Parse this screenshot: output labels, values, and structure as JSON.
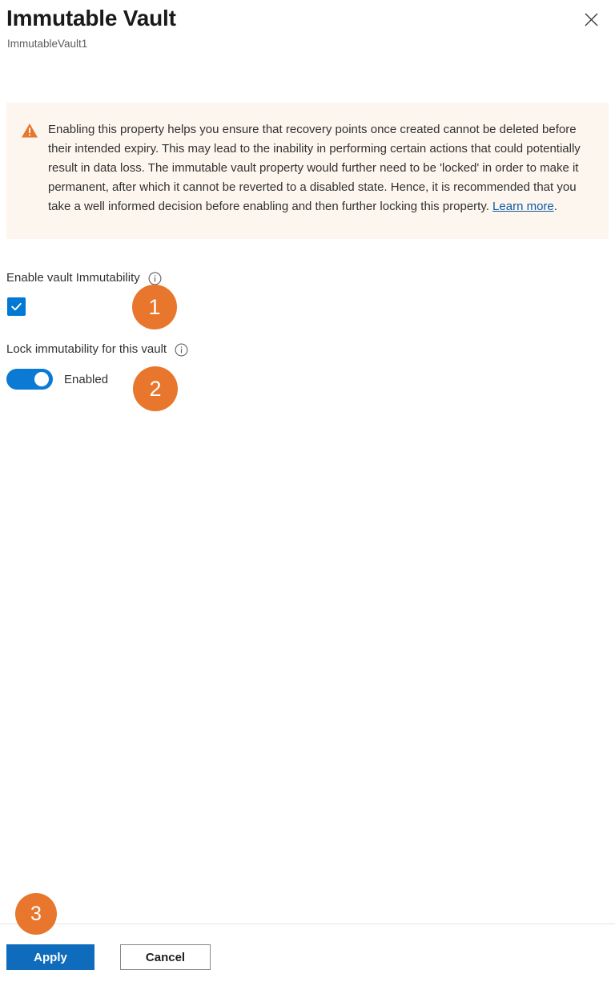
{
  "panel": {
    "title": "Immutable Vault",
    "subtitle": "ImmutableVault1",
    "close_icon": "close-icon"
  },
  "warning": {
    "icon": "warning-triangle-icon",
    "text_before_link": "Enabling this property helps you ensure that recovery points once created cannot be deleted before their intended expiry. This may lead to the inability in performing certain actions that could potentially result in data loss. The immutable vault property would further need to be 'locked' in order to make it permanent, after which it cannot be reverted to a disabled state. Hence, it is recommended that you take a well informed decision before enabling and then further locking this property. ",
    "link_label": "Learn more",
    "text_after_link": ".",
    "background_color": "#fdf6ef",
    "icon_color": "#e8762c",
    "link_color": "#0f5ba7"
  },
  "fields": {
    "enable_immutability": {
      "label": "Enable vault Immutability",
      "info_icon": "info-icon",
      "checkbox_checked": true,
      "accent_color": "#0078d4"
    },
    "lock_immutability": {
      "label": "Lock immutability for this vault",
      "info_icon": "info-icon",
      "toggle_on": true,
      "toggle_state_text": "Enabled",
      "accent_color": "#0a7ad4"
    }
  },
  "footer": {
    "apply_label": "Apply",
    "cancel_label": "Cancel",
    "apply_color": "#0f6cbd"
  },
  "annotations": {
    "badge_color": "#e8762c",
    "items": [
      {
        "number": "1"
      },
      {
        "number": "2"
      },
      {
        "number": "3"
      }
    ]
  }
}
